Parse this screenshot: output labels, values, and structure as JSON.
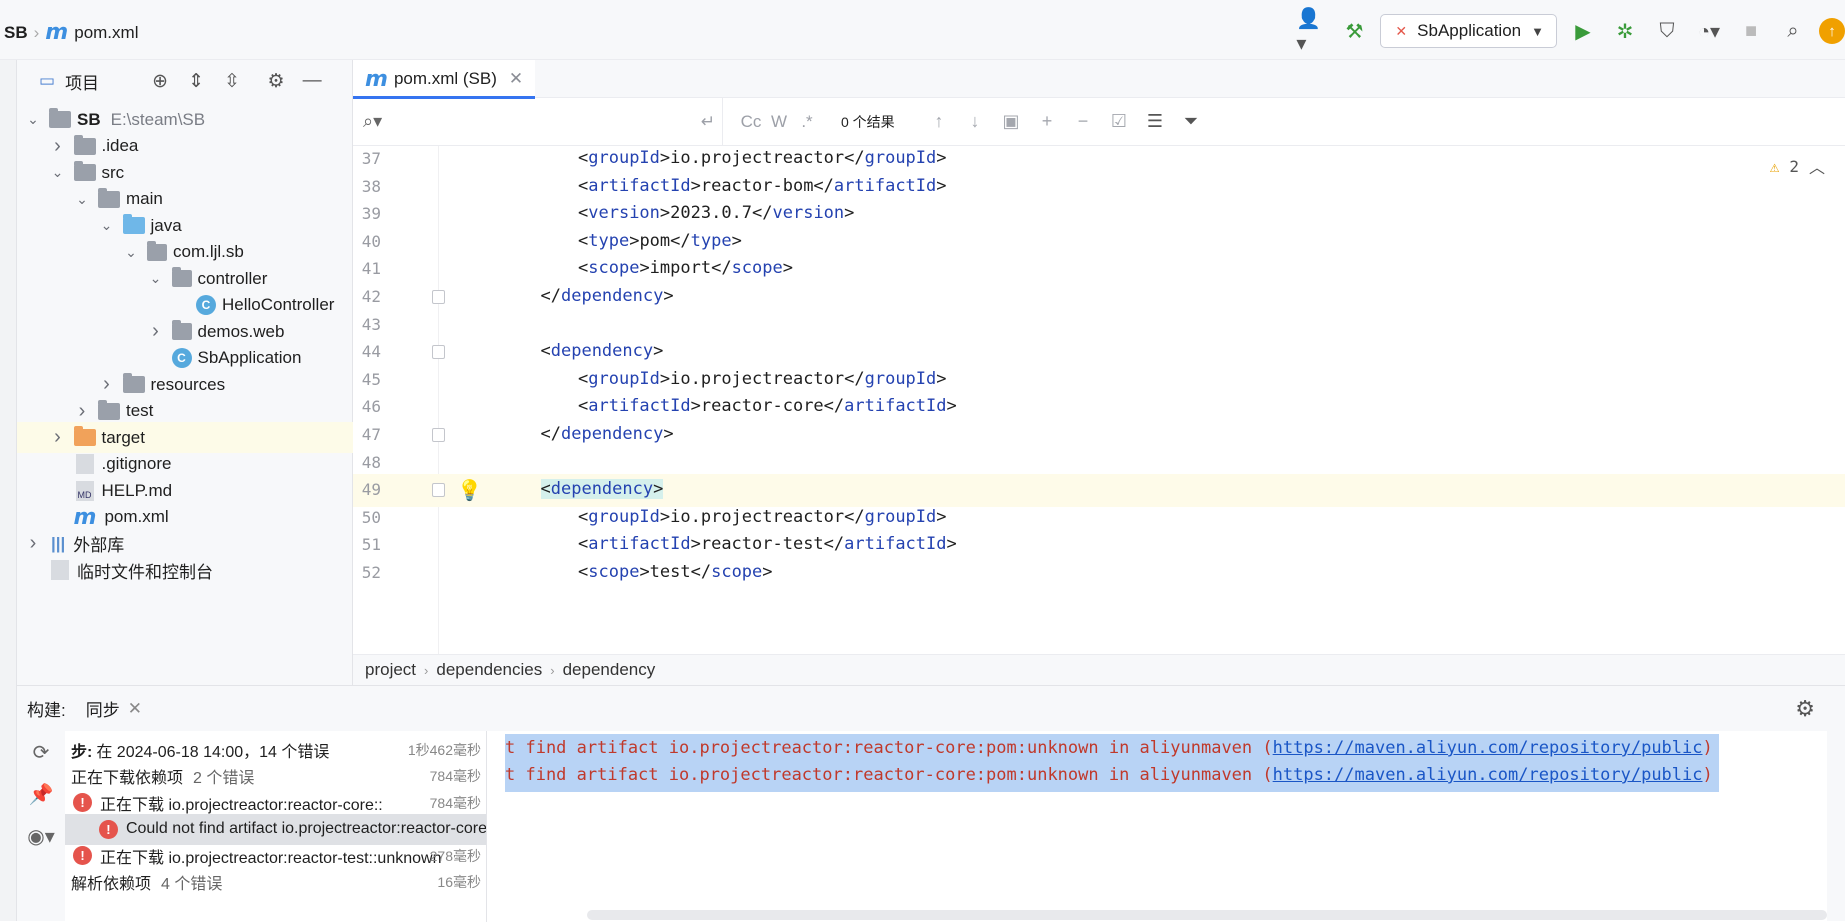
{
  "topbar": {
    "project": "SB",
    "file": "pom.xml",
    "run_config": "SbApplication"
  },
  "project_panel": {
    "title": "项目",
    "tree": [
      {
        "depth": 0,
        "label": "SB",
        "dim": "E:\\steam\\SB",
        "icon": "project-folder-icon",
        "chev": "down"
      },
      {
        "depth": 1,
        "label": ".idea",
        "icon": "folder-icon",
        "chev": "right"
      },
      {
        "depth": 1,
        "label": "src",
        "icon": "folder-icon",
        "chev": "down"
      },
      {
        "depth": 2,
        "label": "main",
        "icon": "folder-icon",
        "chev": "down"
      },
      {
        "depth": 3,
        "label": "java",
        "icon": "source-folder-icon",
        "chev": "down"
      },
      {
        "depth": 4,
        "label": "com.ljl.sb",
        "icon": "package-icon",
        "chev": "down"
      },
      {
        "depth": 5,
        "label": "controller",
        "icon": "package-icon",
        "chev": "down"
      },
      {
        "depth": 6,
        "label": "HelloController",
        "icon": "class-icon",
        "chev": ""
      },
      {
        "depth": 5,
        "label": "demos.web",
        "icon": "package-icon",
        "chev": "right"
      },
      {
        "depth": 5,
        "label": "SbApplication",
        "icon": "class-icon",
        "chev": ""
      },
      {
        "depth": 3,
        "label": "resources",
        "icon": "resources-folder-icon",
        "chev": "right"
      },
      {
        "depth": 2,
        "label": "test",
        "icon": "folder-icon",
        "chev": "right"
      },
      {
        "depth": 1,
        "label": "target",
        "icon": "excluded-folder-icon",
        "chev": "right",
        "selected": true
      },
      {
        "depth": 1,
        "label": ".gitignore",
        "icon": "gitignore-file-icon",
        "chev": ""
      },
      {
        "depth": 1,
        "label": "HELP.md",
        "icon": "markdown-file-icon",
        "chev": ""
      },
      {
        "depth": 1,
        "label": "pom.xml",
        "icon": "maven-file-icon",
        "chev": ""
      },
      {
        "depth": 0,
        "label": "外部库",
        "icon": "library-icon",
        "chev": "right"
      },
      {
        "depth": 0,
        "label": "临时文件和控制台",
        "icon": "scratch-icon",
        "chev": ""
      }
    ]
  },
  "editor": {
    "tab_label": "pom.xml (SB)",
    "find": {
      "result_count": "0 个结果"
    },
    "warnings": "2",
    "lines": [
      {
        "n": "37",
        "indent": 2,
        "parts": [
          "<",
          "groupId",
          ">io.projectreactor</",
          "groupId",
          ">"
        ]
      },
      {
        "n": "38",
        "indent": 2,
        "parts": [
          "<",
          "artifactId",
          ">reactor-bom</",
          "artifactId",
          ">"
        ]
      },
      {
        "n": "39",
        "indent": 2,
        "parts": [
          "<",
          "version",
          ">2023.0.7</",
          "version",
          ">"
        ]
      },
      {
        "n": "40",
        "indent": 2,
        "parts": [
          "<",
          "type",
          ">pom</",
          "type",
          ">"
        ]
      },
      {
        "n": "41",
        "indent": 2,
        "parts": [
          "<",
          "scope",
          ">import</",
          "scope",
          ">"
        ]
      },
      {
        "n": "42",
        "indent": 1,
        "parts": [
          "</",
          "dependency",
          ">"
        ],
        "fold": true
      },
      {
        "n": "43",
        "indent": 0,
        "parts": []
      },
      {
        "n": "44",
        "indent": 1,
        "parts": [
          "<",
          "dependency",
          ">"
        ],
        "fold": true
      },
      {
        "n": "45",
        "indent": 2,
        "parts": [
          "<",
          "groupId",
          ">io.projectreactor</",
          "groupId",
          ">"
        ]
      },
      {
        "n": "46",
        "indent": 2,
        "parts": [
          "<",
          "artifactId",
          ">reactor-core</",
          "artifactId",
          ">"
        ]
      },
      {
        "n": "47",
        "indent": 1,
        "parts": [
          "</",
          "dependency",
          ">"
        ],
        "fold": true
      },
      {
        "n": "48",
        "indent": 0,
        "parts": []
      },
      {
        "n": "49",
        "indent": 1,
        "parts": [
          "<",
          "dependency",
          ">"
        ],
        "fold": true,
        "current": true,
        "bulb": true
      },
      {
        "n": "50",
        "indent": 2,
        "parts": [
          "<",
          "groupId",
          ">io.projectreactor</",
          "groupId",
          ">"
        ]
      },
      {
        "n": "51",
        "indent": 2,
        "parts": [
          "<",
          "artifactId",
          ">reactor-test</",
          "artifactId",
          ">"
        ]
      },
      {
        "n": "52",
        "indent": 2,
        "parts": [
          "<",
          "scope",
          ">test</",
          "scope",
          ">"
        ]
      }
    ],
    "breadcrumb": [
      "project",
      "dependencies",
      "dependency"
    ]
  },
  "build": {
    "label": "构建:",
    "tab": "同步",
    "rows": [
      {
        "indent": 0,
        "prefix": "步:",
        "text": "在 2024-06-18 14:00，14 个错误",
        "time": "1秒462毫秒",
        "err": false
      },
      {
        "indent": 0,
        "text": "正在下载依赖项",
        "sub": "2 个错误",
        "time": "784毫秒",
        "err": false
      },
      {
        "indent": 1,
        "text": "正在下载 io.projectreactor:reactor-core::",
        "time": "784毫秒",
        "err": true
      },
      {
        "indent": 2,
        "text": "Could not find artifact io.projectreactor:reactor-core",
        "time": "",
        "err": true,
        "selected": true
      },
      {
        "indent": 1,
        "text": "正在下载 io.projectreactor:reactor-test::unknown",
        "time": "278毫秒",
        "err": true
      },
      {
        "indent": 0,
        "text": "解析依赖项",
        "sub": "4 个错误",
        "time": "16毫秒",
        "err": false
      }
    ],
    "output": [
      {
        "text": "t find artifact io.projectreactor:reactor-core:pom:unknown in aliyunmaven (",
        "link": "https://maven.aliyun.com/repository/public",
        "tail": ")"
      },
      {
        "text": "t find artifact io.projectreactor:reactor-core:pom:unknown in aliyunmaven (",
        "link": "https://maven.aliyun.com/repository/public",
        "tail": ")"
      }
    ]
  }
}
